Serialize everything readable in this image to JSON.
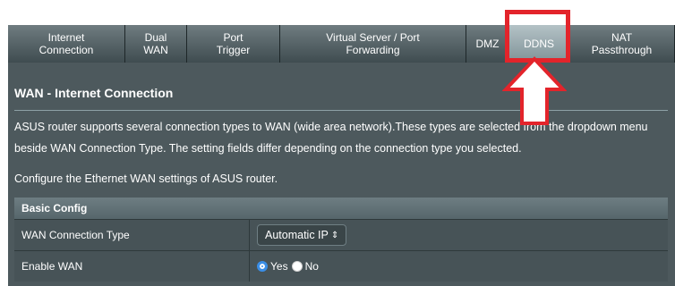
{
  "tabs": [
    {
      "label": "Internet\nConnection",
      "active": false
    },
    {
      "label": "Dual\nWAN",
      "active": false
    },
    {
      "label": "Port\nTrigger",
      "active": false
    },
    {
      "label": "Virtual Server / Port\nForwarding",
      "active": false
    },
    {
      "label": "DMZ",
      "active": false
    },
    {
      "label": "DDNS",
      "active": true
    },
    {
      "label": "NAT\nPassthrough",
      "active": false
    }
  ],
  "page": {
    "title": "WAN - Internet Connection",
    "description": "ASUS router supports several connection types to WAN (wide area network).These types are selected from the dropdown menu beside WAN Connection Type. The setting fields differ depending on the connection type you selected.",
    "subtext": "Configure the Ethernet WAN settings of ASUS router."
  },
  "basic_config": {
    "header": "Basic Config",
    "rows": {
      "wan_type": {
        "label": "WAN Connection Type",
        "value": "Automatic IP",
        "arrow": "⇕"
      },
      "enable_wan": {
        "label": "Enable WAN",
        "yes": "Yes",
        "no": "No",
        "selected": "Yes"
      }
    }
  },
  "colors": {
    "highlight": "#e3242b",
    "panel": "#4d595d",
    "radio_on": "#3a8ee6"
  }
}
